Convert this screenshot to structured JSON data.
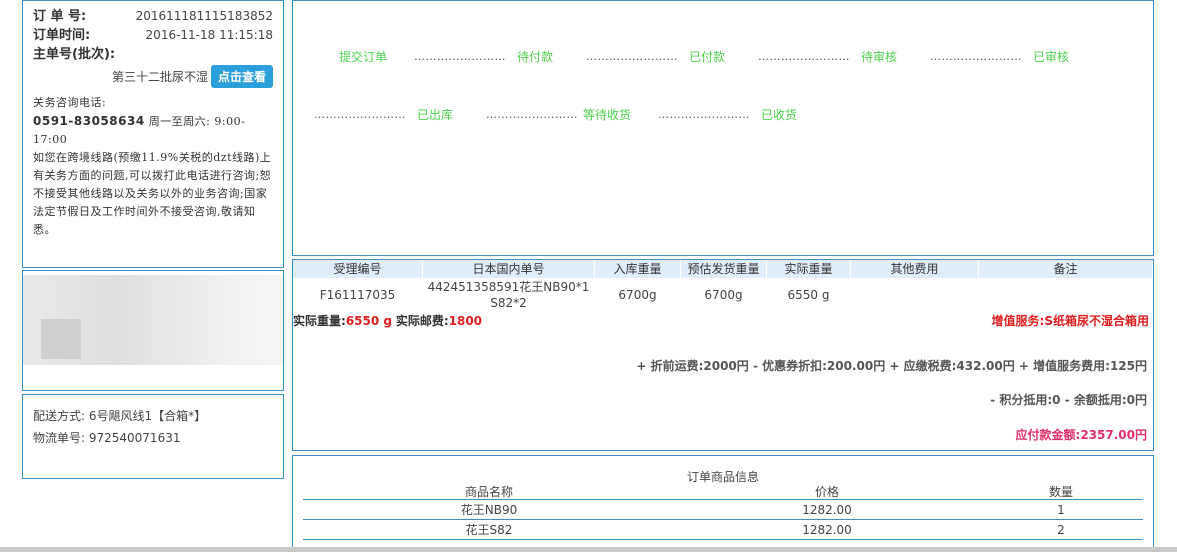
{
  "order": {
    "order_no_label": "订 单 号:",
    "order_no": "201611181115183852",
    "order_time_label": "订单时间:",
    "order_time": "2016-11-18 11:15:18",
    "master_label": "主单号(批次):",
    "batch_text": "第三十二批尿不湿",
    "view_button": "点击查看"
  },
  "consult": {
    "title": "关务咨询电话:",
    "phone": "0591-83058634",
    "hours": "周一至周六: 9:00-17:00",
    "note": "如您在跨境线路(预缴11.9%关税的dzt线路)上有关务方面的问题,可以拨打此电话进行咨询;恕不接受其他线路以及关务以外的业务咨询;国家法定节假日及工作时间外不接受咨询,敬请知悉。"
  },
  "shipping": {
    "method": "配送方式: 6号飓风线1【合箱*】",
    "tracking": "物流单号: 972540071631"
  },
  "steps": {
    "row1": [
      "提交订单",
      "待付款",
      "已付款",
      "待审核",
      "已审核"
    ],
    "row2": [
      "已出库",
      "等待收货",
      "已收货"
    ],
    "dots": "……………………"
  },
  "detail": {
    "headers": [
      "受理编号",
      "日本国内单号",
      "入库重量",
      "预估发货重量",
      "实际重量",
      "其他费用",
      "备注"
    ],
    "row": [
      "F161117035",
      "442451358591花王NB90*1 S82*2",
      "6700g",
      "6700g",
      "6550 g",
      "",
      ""
    ],
    "actual_weight_label": "实际重量:",
    "actual_weight": "6550 g",
    "postage_label": "实际邮费:",
    "postage": "1800",
    "value_added": "增值服务:S纸箱尿不湿合箱用",
    "fee_line": "+ 折前运费:2000円 - 优惠券折扣:200.00円 + 应缴税费:432.00円 + 增值服务费用:125円",
    "deduct_line": "- 积分抵用:0 - 余额抵用:0円",
    "payable": "应付款金额:2357.00円"
  },
  "goods": {
    "title": "订单商品信息",
    "headers": [
      "商品名称",
      "价格",
      "数量"
    ],
    "rows": [
      [
        "花王NB90",
        "1282.00",
        "1"
      ],
      [
        "花王S82",
        "1282.00",
        "2"
      ]
    ]
  }
}
